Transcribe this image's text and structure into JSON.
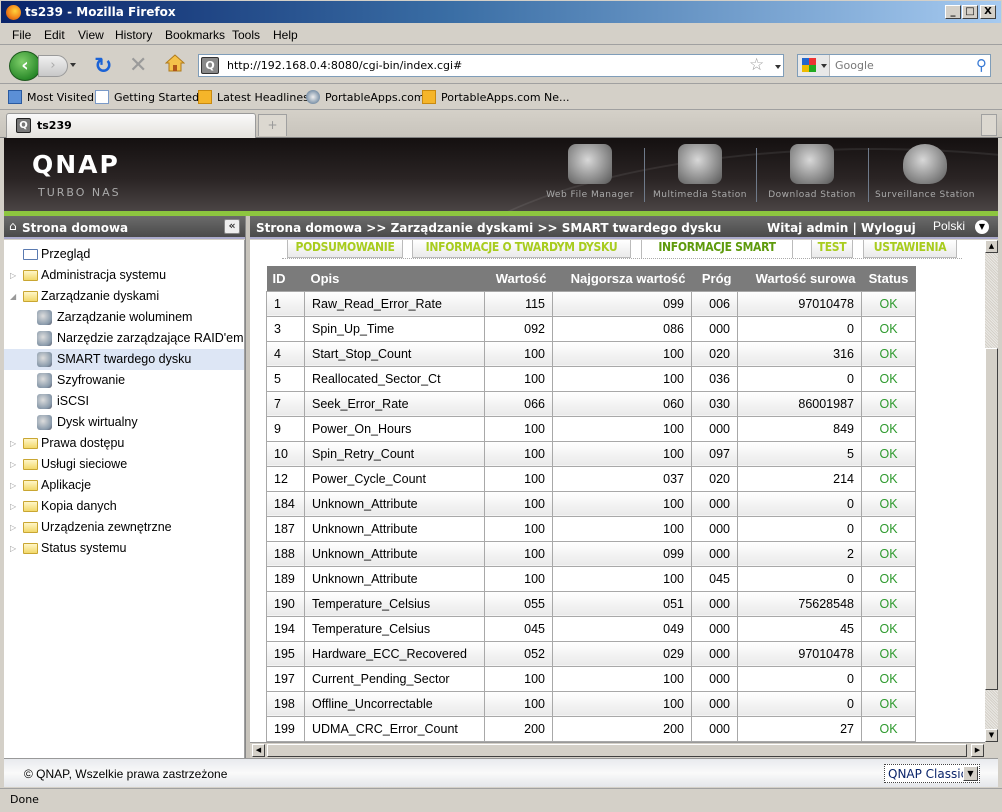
{
  "window": {
    "title": "ts239 - Mozilla Firefox",
    "controls": [
      "_",
      "□",
      "X"
    ]
  },
  "menu": [
    "File",
    "Edit",
    "View",
    "History",
    "Bookmarks",
    "Tools",
    "Help"
  ],
  "nav": {
    "url": "http://192.168.0.4:8080/cgi-bin/index.cgi#",
    "search_placeholder": "Google"
  },
  "bookmarks": [
    "Most Visited",
    "Getting Started",
    "Latest Headlines",
    "PortableApps.com",
    "PortableApps.com Ne..."
  ],
  "browser_tab": {
    "label": "ts239",
    "new_tab": "+"
  },
  "qnap": {
    "logo": "QNAP",
    "subtitle": "TURBO NAS",
    "apps": [
      "Web File Manager",
      "Multimedia Station",
      "Download Station",
      "Surveillance Station"
    ],
    "accent_color": "#8dc63f"
  },
  "sidebar": {
    "title": "Strona domowa",
    "collapse": "«",
    "items": [
      {
        "label": "Przegląd",
        "level": 0,
        "type": "page"
      },
      {
        "label": "Administracja systemu",
        "level": 0,
        "type": "folder",
        "expanded": false
      },
      {
        "label": "Zarządzanie dyskami",
        "level": 0,
        "type": "folder",
        "expanded": true
      },
      {
        "label": "Zarządzanie woluminem",
        "level": 1,
        "type": "page"
      },
      {
        "label": "Narzędzie zarządzające RAID'em",
        "level": 1,
        "type": "page"
      },
      {
        "label": "SMART twardego dysku",
        "level": 1,
        "type": "page",
        "selected": true
      },
      {
        "label": "Szyfrowanie",
        "level": 1,
        "type": "page"
      },
      {
        "label": "iSCSI",
        "level": 1,
        "type": "page"
      },
      {
        "label": "Dysk wirtualny",
        "level": 1,
        "type": "page"
      },
      {
        "label": "Prawa dostępu",
        "level": 0,
        "type": "folder",
        "expanded": false
      },
      {
        "label": "Usługi sieciowe",
        "level": 0,
        "type": "folder",
        "expanded": false
      },
      {
        "label": "Aplikacje",
        "level": 0,
        "type": "folder",
        "expanded": false
      },
      {
        "label": "Kopia danych",
        "level": 0,
        "type": "folder",
        "expanded": false
      },
      {
        "label": "Urządzenia zewnętrzne",
        "level": 0,
        "type": "folder",
        "expanded": false
      },
      {
        "label": "Status systemu",
        "level": 0,
        "type": "folder",
        "expanded": false
      }
    ]
  },
  "header": {
    "breadcrumb": "Strona domowa >> Zarządzanie dyskami >> SMART twardego dysku",
    "welcome": "Witaj admin | Wyloguj",
    "language": "Polski"
  },
  "tabs": [
    {
      "label": "PODSUMOWANIE",
      "active": false
    },
    {
      "label": "INFORMACJE O TWARDYM DYSKU",
      "active": false
    },
    {
      "label": "INFORMACJE SMART",
      "active": true
    },
    {
      "label": "TEST",
      "active": false
    },
    {
      "label": "USTAWIENIA",
      "active": false
    }
  ],
  "table": {
    "columns": [
      "ID",
      "Opis",
      "Wartość",
      "Najgorsza wartość",
      "Próg",
      "Wartość surowa",
      "Status"
    ],
    "rows": [
      [
        "1",
        "Raw_Read_Error_Rate",
        "115",
        "099",
        "006",
        "97010478",
        "OK"
      ],
      [
        "3",
        "Spin_Up_Time",
        "092",
        "086",
        "000",
        "0",
        "OK"
      ],
      [
        "4",
        "Start_Stop_Count",
        "100",
        "100",
        "020",
        "316",
        "OK"
      ],
      [
        "5",
        "Reallocated_Sector_Ct",
        "100",
        "100",
        "036",
        "0",
        "OK"
      ],
      [
        "7",
        "Seek_Error_Rate",
        "066",
        "060",
        "030",
        "86001987",
        "OK"
      ],
      [
        "9",
        "Power_On_Hours",
        "100",
        "100",
        "000",
        "849",
        "OK"
      ],
      [
        "10",
        "Spin_Retry_Count",
        "100",
        "100",
        "097",
        "5",
        "OK"
      ],
      [
        "12",
        "Power_Cycle_Count",
        "100",
        "037",
        "020",
        "214",
        "OK"
      ],
      [
        "184",
        "Unknown_Attribute",
        "100",
        "100",
        "000",
        "0",
        "OK"
      ],
      [
        "187",
        "Unknown_Attribute",
        "100",
        "100",
        "000",
        "0",
        "OK"
      ],
      [
        "188",
        "Unknown_Attribute",
        "100",
        "099",
        "000",
        "2",
        "OK"
      ],
      [
        "189",
        "Unknown_Attribute",
        "100",
        "100",
        "045",
        "0",
        "OK"
      ],
      [
        "190",
        "Temperature_Celsius",
        "055",
        "051",
        "000",
        "75628548",
        "OK"
      ],
      [
        "194",
        "Temperature_Celsius",
        "045",
        "049",
        "000",
        "45",
        "OK"
      ],
      [
        "195",
        "Hardware_ECC_Recovered",
        "052",
        "029",
        "000",
        "97010478",
        "OK"
      ],
      [
        "197",
        "Current_Pending_Sector",
        "100",
        "100",
        "000",
        "0",
        "OK"
      ],
      [
        "198",
        "Offline_Uncorrectable",
        "100",
        "100",
        "000",
        "0",
        "OK"
      ],
      [
        "199",
        "UDMA_CRC_Error_Count",
        "200",
        "200",
        "000",
        "27",
        "OK"
      ]
    ]
  },
  "footer": {
    "copyright": "© QNAP, Wszelkie prawa zastrzeżone",
    "theme": "QNAP Classic"
  },
  "status": "Done"
}
